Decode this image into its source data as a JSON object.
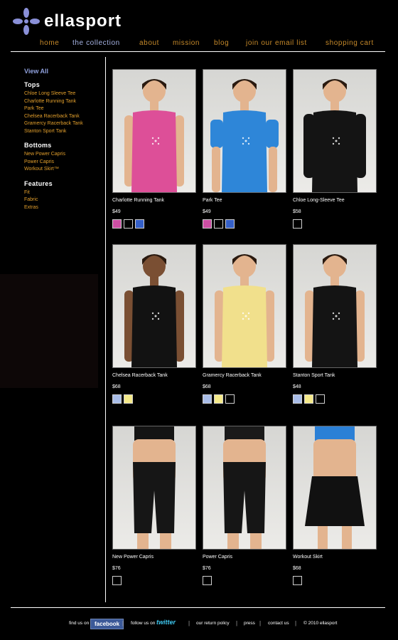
{
  "brand": {
    "name": "ellasport",
    "logo_color": "#8a90d8"
  },
  "nav": {
    "items": [
      "home",
      "the collection",
      "about",
      "mission",
      "blog",
      "join our email list",
      "shopping cart"
    ],
    "active": "the collection"
  },
  "sidebar": {
    "view_all": "View All",
    "tops": {
      "heading": "Tops",
      "links": [
        "Chloe Long Sleeve Tee",
        "Charlotte Running Tank",
        "Park Tee",
        "Chelsea Racerback Tank",
        "Gramercy Racerback Tank",
        "Stanton Sport Tank"
      ]
    },
    "bottoms": {
      "heading": "Bottoms",
      "links": [
        "New Power Capris",
        "Power Capris",
        "Workout Skirt™"
      ]
    },
    "features": {
      "heading": "Features",
      "links": [
        "Fit",
        "Fabric",
        "Extras"
      ]
    }
  },
  "products": [
    {
      "name": "Charlotte Running Tank",
      "price": "$49",
      "colors": [
        "#cc4ea3",
        "#000000",
        "#3560c8"
      ],
      "garment": "tank",
      "top": "#dd4f98",
      "skin": "#e3b48f"
    },
    {
      "name": "Park Tee",
      "price": "$49",
      "colors": [
        "#cc4ea3",
        "#000000",
        "#3560c8"
      ],
      "garment": "tee",
      "top": "#2e86d8",
      "skin": "#e3b48f"
    },
    {
      "name": "Chloe Long-Sleeve Tee",
      "price": "$58",
      "colors": [
        "#000000"
      ],
      "garment": "longsleeve",
      "top": "#141414",
      "skin": "#e3b48f"
    },
    {
      "name": "Chelsea Racerback Tank",
      "price": "$68",
      "colors": [
        "#a9bde8",
        "#f5ea8a"
      ],
      "garment": "racer",
      "top": "#121212",
      "skin": "#7a4f33"
    },
    {
      "name": "Gramercy Racerback Tank",
      "price": "$68",
      "colors": [
        "#a9bde8",
        "#f5ea8a",
        "#000000"
      ],
      "garment": "racer",
      "top": "#f1e08c",
      "skin": "#e3b48f"
    },
    {
      "name": "Stanton Sport Tank",
      "price": "$48",
      "colors": [
        "#a9bde8",
        "#f5ea8a",
        "#000000"
      ],
      "garment": "tank",
      "top": "#141414",
      "skin": "#e3b48f"
    },
    {
      "name": "New Power Capris",
      "price": "$76",
      "colors": [
        "#000000"
      ],
      "garment": "capris",
      "top": "#141414",
      "skin": "#e3b48f"
    },
    {
      "name": "Power Capris",
      "price": "$76",
      "colors": [
        "#000000"
      ],
      "garment": "capris",
      "top": "#1a1a1a",
      "skin": "#e3b48f"
    },
    {
      "name": "Workout Skirt",
      "price": "$68",
      "colors": [
        "#000000"
      ],
      "garment": "skirt",
      "top": "#2b80d6",
      "skin": "#e3b48f"
    }
  ],
  "footer": {
    "find_us_on": "find us on",
    "facebook": "facebook",
    "follow_us_on": "follow us on",
    "twitter": "twitter",
    "return_policy": "our return policy",
    "press": "press",
    "contact": "contact us",
    "copyright": "© 2010 ellasport"
  }
}
